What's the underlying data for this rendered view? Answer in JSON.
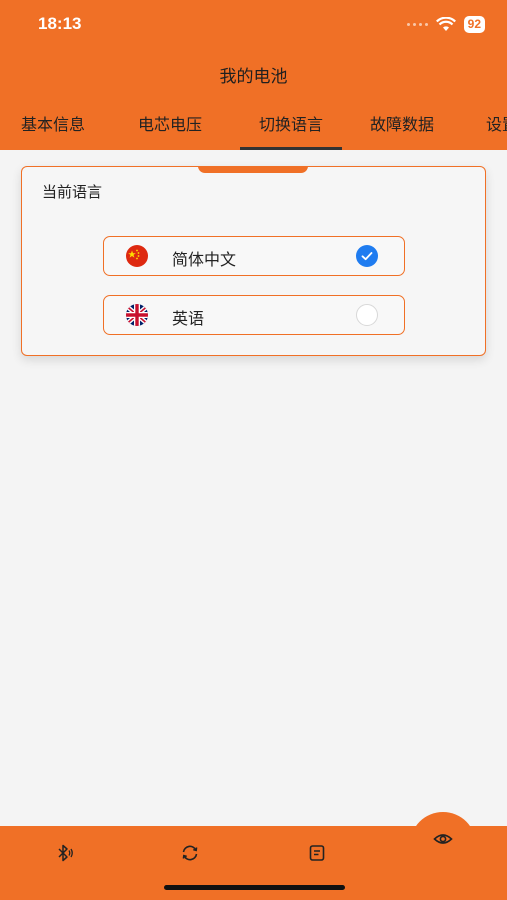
{
  "status_bar": {
    "time": "18:13",
    "battery": "92"
  },
  "header": {
    "title": "我的电池"
  },
  "tabs": [
    {
      "label": "基本信息"
    },
    {
      "label": "电芯电压"
    },
    {
      "label": "切换语言",
      "active": true
    },
    {
      "label": "故障数据"
    },
    {
      "label": "设置"
    }
  ],
  "language_card": {
    "title": "当前语言",
    "options": [
      {
        "label": "简体中文",
        "flag": "china-flag",
        "selected": true
      },
      {
        "label": "英语",
        "flag": "uk-flag",
        "selected": false
      }
    ]
  },
  "bottom_nav": [
    {
      "icon": "bluetooth-icon"
    },
    {
      "icon": "refresh-icon"
    },
    {
      "icon": "document-icon"
    },
    {
      "icon": "eye-icon",
      "active": true
    }
  ],
  "colors": {
    "accent": "#f07026",
    "check": "#1f7cf0",
    "background": "#f4f4f4"
  }
}
